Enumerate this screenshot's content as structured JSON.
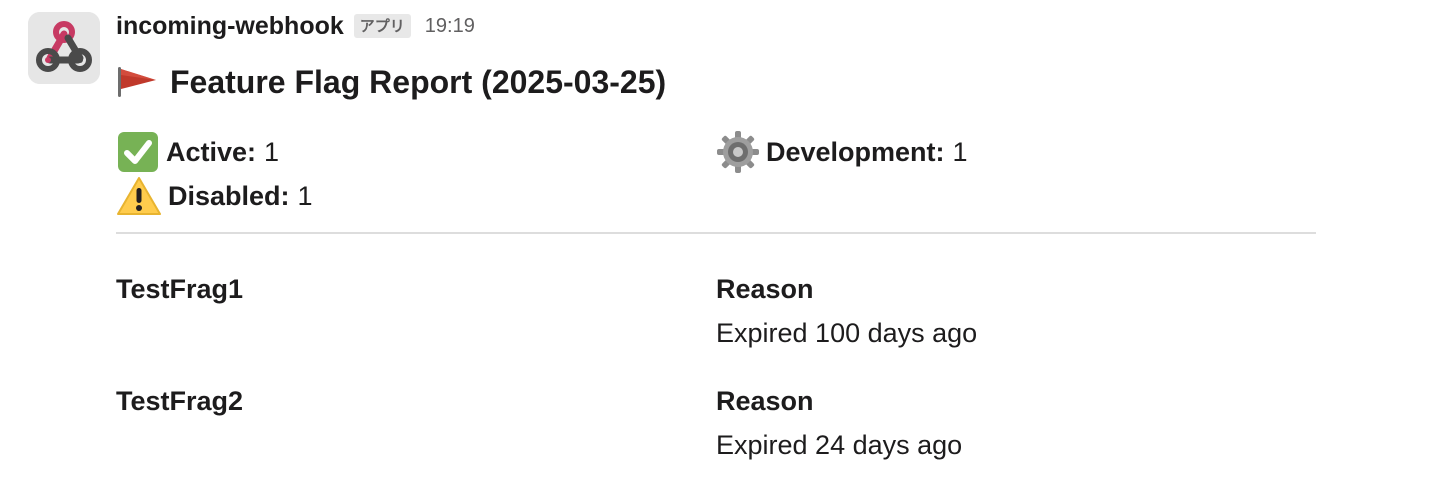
{
  "message": {
    "sender_name": "incoming-webhook",
    "app_badge": "アプリ",
    "timestamp": "19:19",
    "avatar_icon": "webhook-icon",
    "title_icon": "red-flag-icon",
    "title": "Feature Flag Report (2025-03-25)"
  },
  "summary": {
    "active": {
      "icon": "check-mark-icon",
      "label": "Active:",
      "value": "1"
    },
    "development": {
      "icon": "gear-icon",
      "label": "Development:",
      "value": "1"
    },
    "disabled": {
      "icon": "warning-icon",
      "label": "Disabled:",
      "value": "1"
    }
  },
  "flags": [
    {
      "name": "TestFrag1",
      "reason_label": "Reason",
      "reason": "Expired 100 days ago"
    },
    {
      "name": "TestFrag2",
      "reason_label": "Reason",
      "reason": "Expired 24 days ago"
    }
  ],
  "colors": {
    "text": "#1d1c1d",
    "muted": "#616061",
    "avatar_bg": "#e6e6e6",
    "webhook_pink": "#c73a63",
    "webhook_dark": "#4a4a4a",
    "flag_red": "#c0392b",
    "check_green": "#77b255",
    "warning_yellow": "#ffcc4d",
    "divider": "#dddddd"
  }
}
